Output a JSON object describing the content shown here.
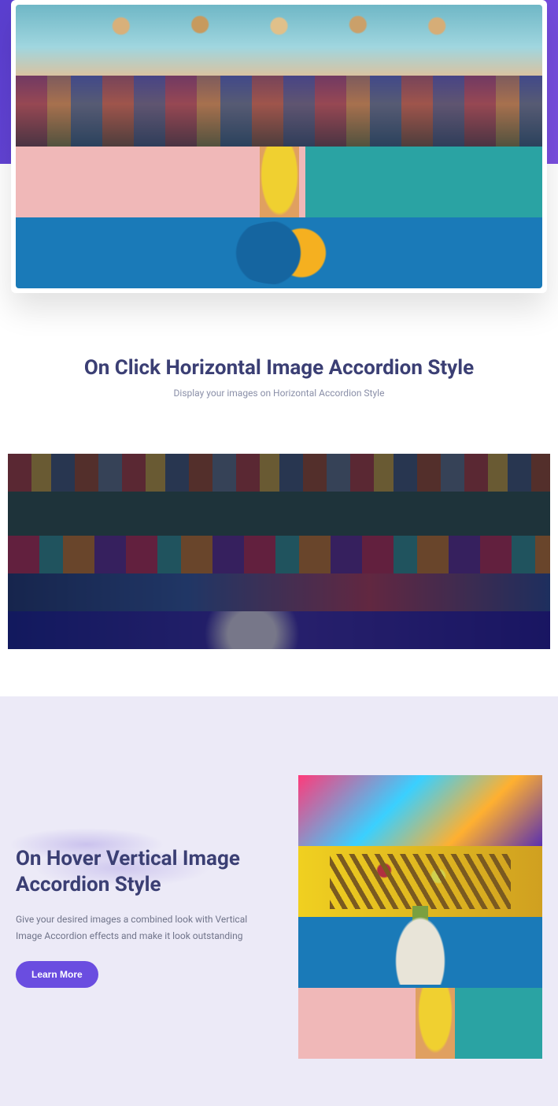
{
  "hero": {
    "rows": [
      "beach-people",
      "colorful-city",
      "pink-teal-wall-cup",
      "blue-fruit"
    ]
  },
  "section_horizontal": {
    "title": "On Click Horizontal Image Accordion Style",
    "subtitle": "Display your images on Horizontal Accordion Style",
    "rows": [
      "city-row",
      "dark-green-stick",
      "graffiti-wall",
      "anime-mural",
      "stage-lights"
    ]
  },
  "section_vertical": {
    "title": "On Hover Vertical Image Accordion Style",
    "description": "Give your desired images a combined look with Vertical Image Accordion effects and make it look outstanding",
    "button_label": "Learn More",
    "rows": [
      "neon-portrait",
      "yellow-flowers-basket",
      "blue-pineapple",
      "pink-teal-wall-cup"
    ]
  }
}
